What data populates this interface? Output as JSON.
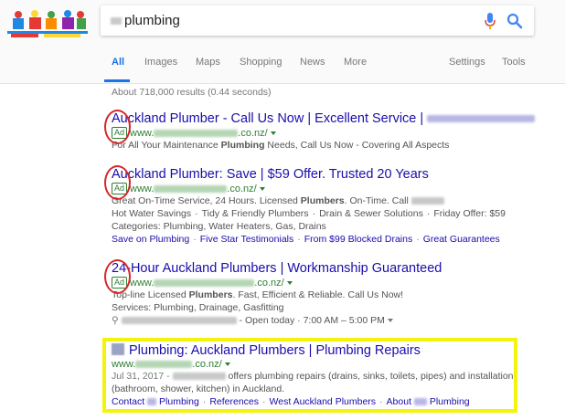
{
  "search": {
    "query": "plumbing"
  },
  "tabs": [
    "All",
    "Images",
    "Maps",
    "Shopping",
    "News",
    "More"
  ],
  "tools": {
    "settings": "Settings",
    "tools": "Tools"
  },
  "stats": "About 718,000 results (0.44 seconds)",
  "results": [
    {
      "title": "Auckland Plumber - Call Us Now | Excellent Service |",
      "ad_label": "Ad",
      "url_prefix": "www.",
      "url_suffix": ".co.nz/",
      "desc1_pre": "For All Your Maintenance ",
      "desc1_bold": "Plumbing",
      "desc1_post": " Needs, Call Us Now - Covering All Aspects"
    },
    {
      "title": "Auckland Plumber: Save | $59 Offer. Trusted 20 Years",
      "ad_label": "Ad",
      "url_prefix": "www.",
      "url_suffix": ".co.nz/",
      "desc1_pre": "Great On-Time Service, 24 Hours. Licensed ",
      "desc1_bold": "Plumbers",
      "desc1_post": ". On-Time. Call",
      "desc2": [
        "Hot Water Savings",
        "Tidy & Friendly Plumbers",
        "Drain & Sewer Solutions",
        "Friday Offer: $59"
      ],
      "desc3": "Categories: Plumbing, Water Heaters, Gas, Drains",
      "sitelinks": [
        "Save on Plumbing",
        "Five Star Testimonials",
        "From $99 Blocked Drains",
        "Great Guarantees"
      ]
    },
    {
      "title": "24-Hour Auckland Plumbers | Workmanship Guaranteed",
      "ad_label": "Ad",
      "url_prefix": "www.",
      "url_suffix": ".co.nz/",
      "desc1_pre": "Top-line Licensed ",
      "desc1_bold": "Plumbers",
      "desc1_post": ". Fast, Efficient & Reliable. Call Us Now!",
      "desc2": "Services: Plumbing, Drainage, Gasfitting",
      "hours": "Open today · 7:00 AM – 5:00 PM"
    },
    {
      "title": "Plumbing: Auckland Plumbers | Plumbing Repairs",
      "url_prefix": "www.",
      "url_suffix": ".co.nz/",
      "date": "Jul 31, 2017 -",
      "desc1": "offers plumbing repairs (drains, sinks, toilets, pipes) and installation",
      "desc2": "(bathroom, shower, kitchen) in Auckland.",
      "sitelinks": [
        "Contact",
        "Plumbing",
        "References",
        "West Auckland Plumbers",
        "About",
        "Plumbing"
      ]
    }
  ],
  "colors": {
    "link": "#1a0dab",
    "url": "#2e7d32",
    "accent": "#1a73e8",
    "circle": "#d62828",
    "highlight": "#f4f40a"
  }
}
